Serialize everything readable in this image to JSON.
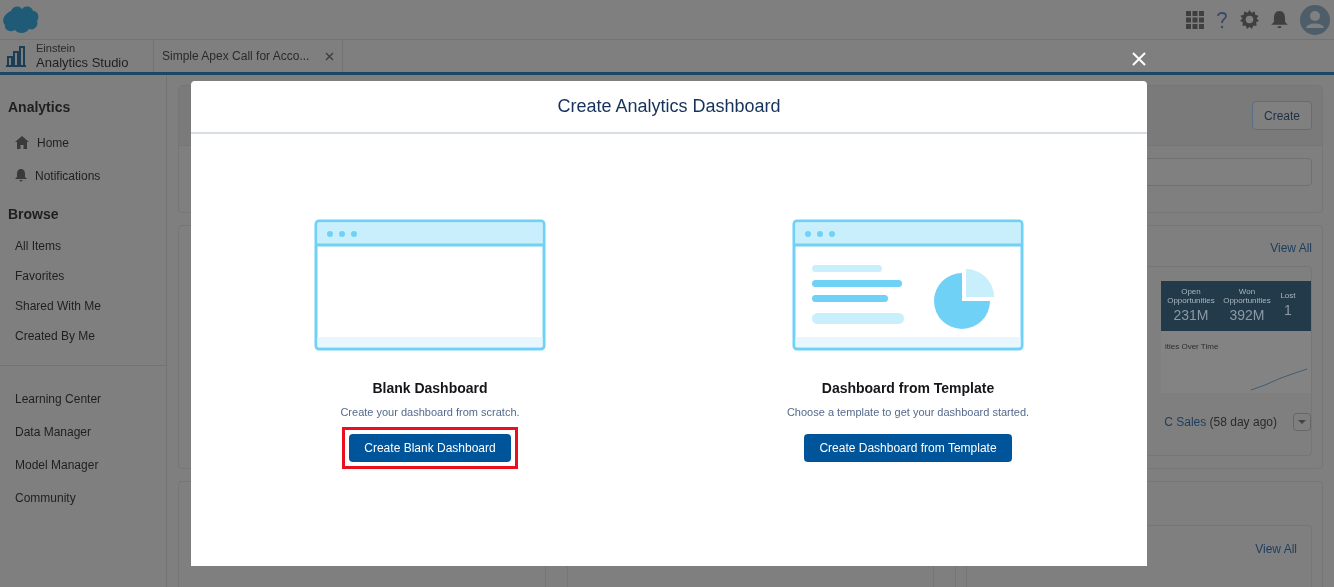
{
  "app": {
    "overline": "Einstein",
    "name": "Analytics Studio"
  },
  "tab": {
    "label": "Simple Apex Call for Acco..."
  },
  "sidebar": [
    {
      "heading": "Analytics",
      "items": [
        {
          "label": "Home",
          "kind": "home"
        },
        {
          "label": "Notifications",
          "kind": "bell"
        }
      ]
    },
    {
      "heading": "Browse",
      "items": [
        {
          "label": "All Items",
          "kind": "plain"
        },
        {
          "label": "Favorites",
          "kind": "plain"
        },
        {
          "label": "Shared With Me",
          "kind": "plain"
        },
        {
          "label": "Created By Me",
          "kind": "plain"
        }
      ]
    },
    {
      "items": [
        {
          "label": "Learning Center",
          "kind": "plain"
        },
        {
          "label": "Data Manager",
          "kind": "plain"
        },
        {
          "label": "Model Manager",
          "kind": "plain"
        },
        {
          "label": "Community",
          "kind": "plain"
        }
      ]
    }
  ],
  "backdrop": {
    "create_button": "Create",
    "view_all": [
      "View All",
      "View All"
    ],
    "kpis": [
      {
        "label": "Open Opportunities",
        "value": "231M"
      },
      {
        "label": "Won Opportunities",
        "value": "392M"
      },
      {
        "label": "Lost",
        "value": "1"
      }
    ],
    "chart_label": "ities Over Time",
    "recent": {
      "link": "C Sales",
      "meta": "(58 day ago)"
    }
  },
  "modal": {
    "title": "Create Analytics Dashboard",
    "options": [
      {
        "kind": "blank",
        "title": "Blank Dashboard",
        "description": "Create your dashboard from scratch.",
        "button": "Create Blank Dashboard",
        "highlighted": true
      },
      {
        "kind": "template",
        "title": "Dashboard from Template",
        "description": "Choose a template to get your dashboard started.",
        "button": "Create Dashboard from Template",
        "highlighted": false
      }
    ]
  }
}
